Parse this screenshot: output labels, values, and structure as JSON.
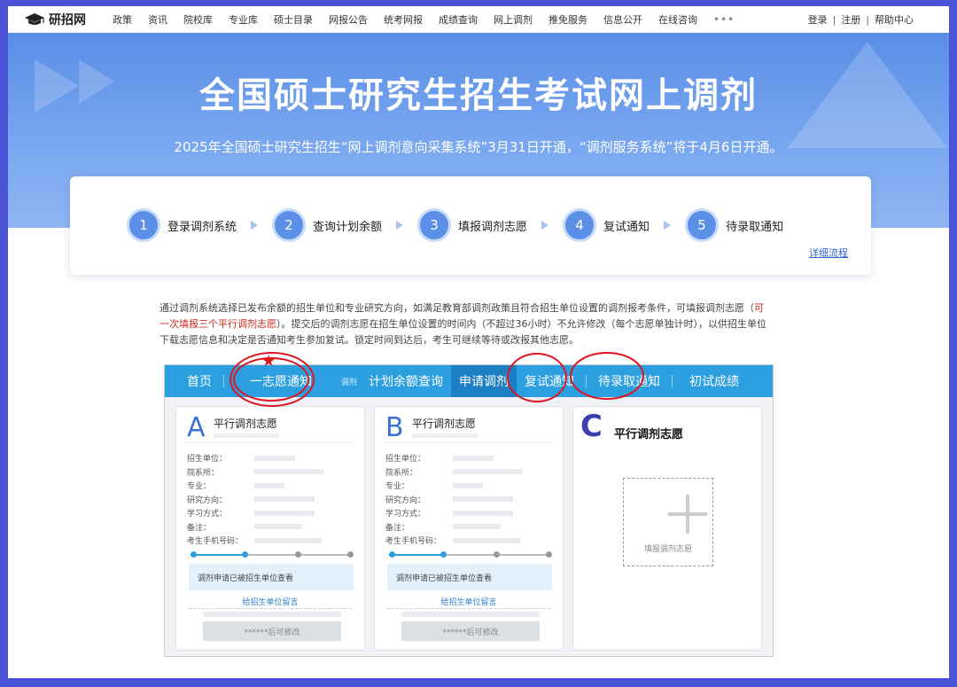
{
  "nav": {
    "logo_text": "研招网",
    "items": [
      "政策",
      "资讯",
      "院校库",
      "专业库",
      "硕士目录",
      "网报公告",
      "统考网报",
      "成绩查询",
      "网上调剂",
      "推免服务",
      "信息公开",
      "在线咨询"
    ],
    "more": "•••",
    "login": "登录",
    "register": "注册",
    "help": "帮助中心",
    "sep": "|"
  },
  "banner": {
    "title": "全国硕士研究生招生考试网上调剂",
    "subtitle": "2025年全国硕士研究生招生“网上调剂意向采集系统”3月31日开通，“调剂服务系统”将于4月6日开通。"
  },
  "steps": [
    {
      "num": "1",
      "label": "登录调剂系统"
    },
    {
      "num": "2",
      "label": "查询计划余额"
    },
    {
      "num": "3",
      "label": "填报调剂志愿"
    },
    {
      "num": "4",
      "label": "复试通知"
    },
    {
      "num": "5",
      "label": "待录取通知"
    }
  ],
  "detail_link": "详细流程",
  "description": {
    "part1": "通过调剂系统选择已发布余额的招生单位和专业研究方向，如满足教育部调剂政策且符合招生单位设置的调剂报考条件，可填报调剂志愿（",
    "highlight": "可一次填报三个平行调剂志愿",
    "part2": "）。提交后的调剂志愿在招生单位设置的时间内（不超过36小时）不允许修改（每个志愿单独计时），以供招生单位下载志愿信息和决定是否通知考生参加复试。锁定时间到达后，考生可继续等待或改报其他志愿。"
  },
  "mock": {
    "tabs": {
      "home": "首页",
      "first_choice": "一志愿通知",
      "small": "调剂",
      "quota": "计划余额查询",
      "apply": "申请调剂",
      "retest": "复试通知",
      "admission": "待录取通知",
      "score": "初试成绩"
    },
    "card_title": "平行调剂志愿",
    "cards": [
      {
        "letter": "A"
      },
      {
        "letter": "B"
      }
    ],
    "fields": [
      "招生单位：",
      "院系所：",
      "专业：",
      "研究方向：",
      "学习方式：",
      "备注：",
      "考生手机号码："
    ],
    "notice": "调剂申请已被招生单位查看",
    "message_link": "给招生单位留言",
    "modify_button": "******后可修改",
    "card_c": {
      "letter": "C",
      "title": "平行调剂志愿",
      "add_label": "填报调剂志愿"
    }
  },
  "annotation": {
    "star": "★"
  },
  "colors": {
    "accent": "#2b9fe0",
    "banner": "#5a8ee6",
    "highlight_red": "#e0141e",
    "frame": "#4a52d6"
  }
}
